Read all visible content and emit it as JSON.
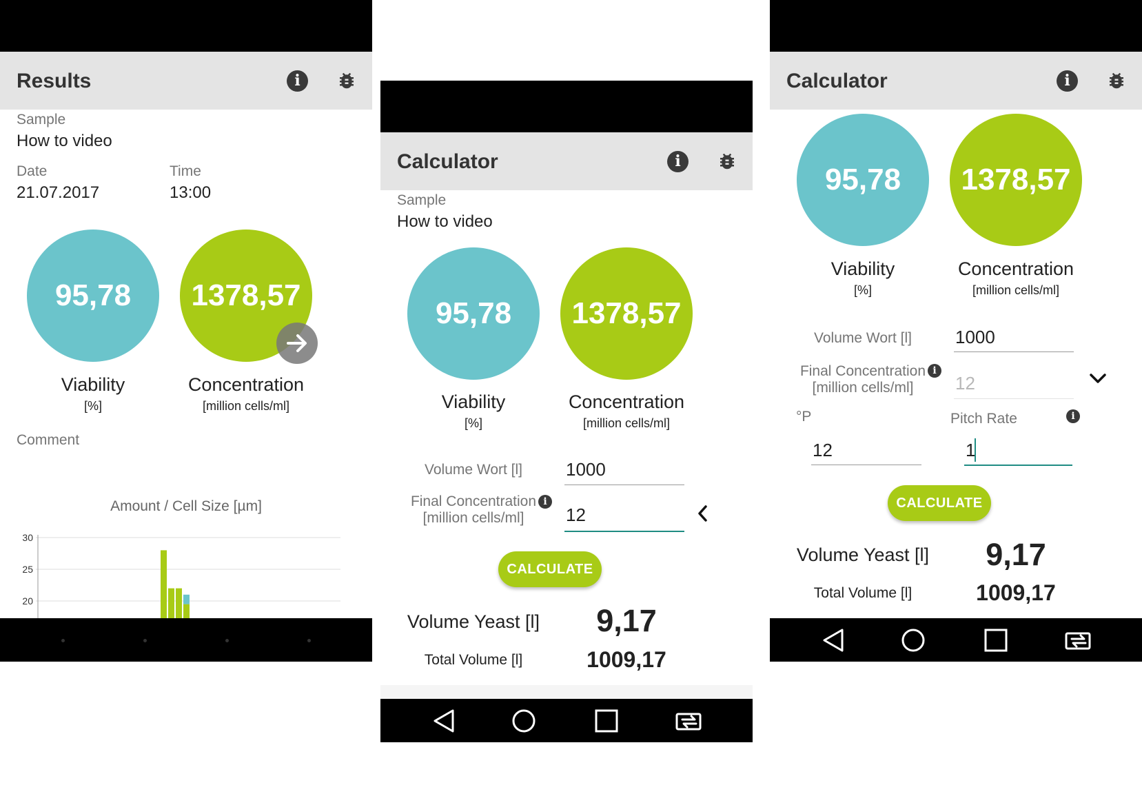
{
  "screen1": {
    "title": "Results",
    "icons": [
      "info-icon",
      "bug-icon"
    ],
    "sample_label": "Sample",
    "sample_value": "How to video",
    "date_label": "Date",
    "date_value": "21.07.2017",
    "time_label": "Time",
    "time_value": "13:00",
    "viability_value": "95,78",
    "viability_label": "Viability",
    "viability_unit": "[%]",
    "concentration_value": "1378,57",
    "concentration_label": "Concentration",
    "concentration_unit": "[million cells/ml]",
    "comment_label": "Comment",
    "chart_title": "Amount / Cell Size [µm]"
  },
  "chart_data": {
    "type": "bar",
    "title": "Amount / Cell Size [µm]",
    "y_ticks": [
      "30",
      "25",
      "20"
    ],
    "ylim": [
      20,
      30
    ],
    "bars_visible": [
      {
        "green": 28,
        "teal": 0
      },
      {
        "green": 22,
        "teal": 0
      },
      {
        "green": 22,
        "teal": 0
      },
      {
        "green": 19.5,
        "teal": 1.5
      }
    ],
    "colors": {
      "green": "#a8cb16",
      "teal": "#6bc4cb"
    },
    "grid": true
  },
  "screen2": {
    "title": "Calculator",
    "sample_label": "Sample",
    "sample_value": "How to video",
    "viability_value": "95,78",
    "viability_label": "Viability",
    "viability_unit": "[%]",
    "concentration_value": "1378,57",
    "concentration_label": "Concentration",
    "concentration_unit": "[million cells/ml]",
    "volume_wort_label": "Volume Wort [l]",
    "volume_wort_value": "1000",
    "final_conc_label": "Final Concentration",
    "final_conc_unit": "[million cells/ml]",
    "final_conc_value": "12",
    "calculate": "CALCULATE",
    "volume_yeast_label": "Volume Yeast [l]",
    "volume_yeast_value": "9,17",
    "total_volume_label": "Total Volume [l]",
    "total_volume_value": "1009,17"
  },
  "screen3": {
    "title": "Calculator",
    "viability_value": "95,78",
    "viability_label": "Viability",
    "viability_unit": "[%]",
    "concentration_value": "1378,57",
    "concentration_label": "Concentration",
    "concentration_unit": "[million cells/ml]",
    "volume_wort_label": "Volume Wort [l]",
    "volume_wort_value": "1000",
    "final_conc_label": "Final Concentration",
    "final_conc_unit": "[million cells/ml]",
    "final_conc_value": "12",
    "plato_label": "°P",
    "plato_value": "12",
    "pitch_rate_label": "Pitch Rate",
    "pitch_rate_value": "1",
    "calculate": "CALCULATE",
    "volume_yeast_label": "Volume Yeast [l]",
    "volume_yeast_value": "9,17",
    "total_volume_label": "Total Volume [l]",
    "total_volume_value": "1009,17"
  },
  "colors": {
    "teal": "#6bc4cb",
    "green": "#a8cb16",
    "accent": "#1f8c83",
    "appbar": "#e4e4e4"
  }
}
